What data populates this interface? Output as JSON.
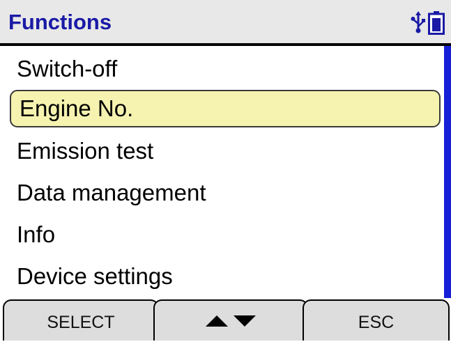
{
  "header": {
    "title": "Functions",
    "icons": [
      "usb-icon",
      "battery-icon"
    ],
    "title_color": "#1a1aa6"
  },
  "menu": {
    "items": [
      {
        "label": "Switch-off",
        "selected": false
      },
      {
        "label": "Engine No.",
        "selected": true
      },
      {
        "label": "Emission test",
        "selected": false
      },
      {
        "label": "Data management",
        "selected": false
      },
      {
        "label": "Info",
        "selected": false
      },
      {
        "label": "Device settings",
        "selected": false
      }
    ],
    "selected_color": "#f6f3b0",
    "scrollbar_color": "#1520d8"
  },
  "softkeys": {
    "select_label": "SELECT",
    "nav_icons": [
      "arrow-up-icon",
      "arrow-down-icon"
    ],
    "esc_label": "ESC"
  }
}
